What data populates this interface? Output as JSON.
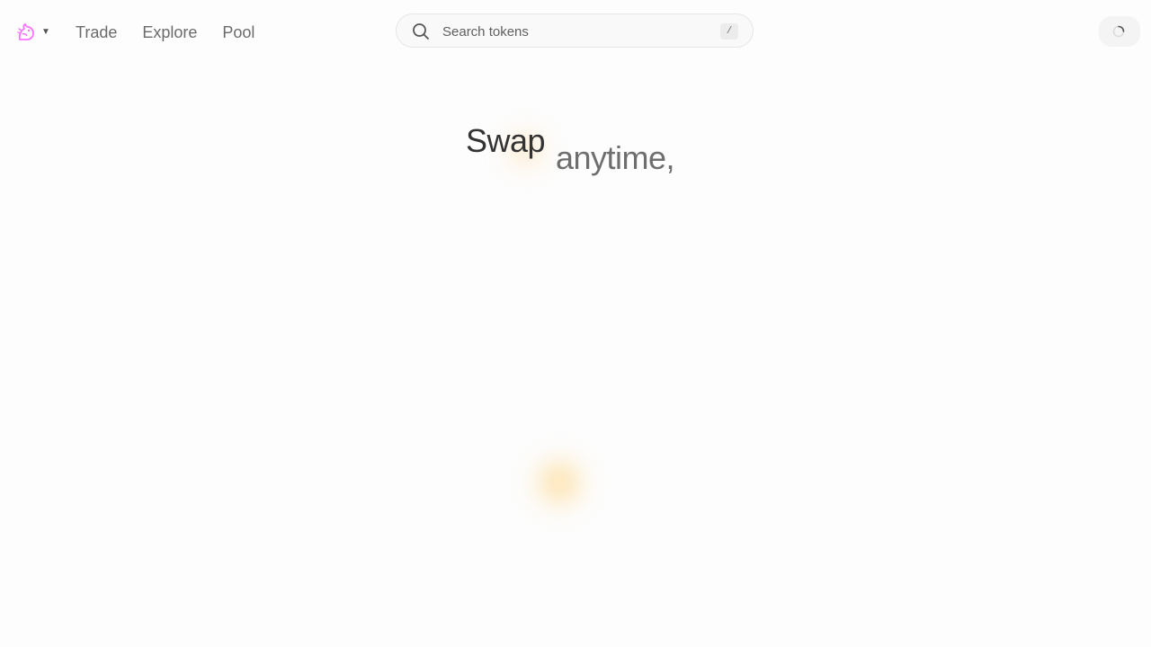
{
  "nav": {
    "logo_icon": "uniswap-unicorn-icon",
    "logo_dropdown_icon": "caret-down-icon",
    "links": [
      "Trade",
      "Explore",
      "Pool"
    ]
  },
  "search": {
    "placeholder": "Search tokens",
    "value": "",
    "hotkey": "/"
  },
  "account": {
    "icon": "loading-spinner-icon"
  },
  "hero": {
    "word_1": "Swap",
    "word_2": "anytime,"
  },
  "colors": {
    "brand_pink": "#fc72ff",
    "background": "#fdfdfd",
    "glow": "#ffc85a"
  }
}
